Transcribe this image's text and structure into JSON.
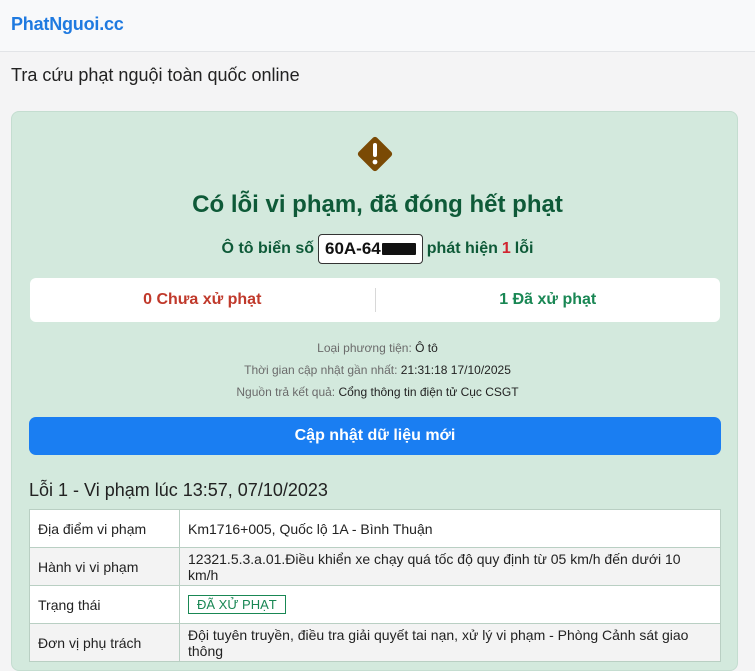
{
  "header": {
    "brand": "PhatNguoi.cc"
  },
  "page": {
    "heading": "Tra cứu phạt nguội toàn quốc online"
  },
  "result": {
    "status_title": "Có lỗi vi phạm, đã đóng hết phạt",
    "plate_prefix": "Ô tô biển số",
    "plate_number": "60A-64",
    "found_prefix": "phát hiện",
    "violation_count": "1",
    "found_suffix": "lỗi",
    "unpaid_label": "0 Chưa xử phạt",
    "paid_label": "1 Đã xử phạt",
    "vehicle_type_label": "Loại phương tiện:",
    "vehicle_type_value": "Ô tô",
    "updated_label": "Thời gian cập nhật gần nhất:",
    "updated_value": "21:31:18 17/10/2025",
    "source_label": "Nguồn trả kết quả:",
    "source_value": "Cổng thông tin điện tử Cục CSGT",
    "update_button": "Cập nhật dữ liệu mới"
  },
  "violation": {
    "title": "Lỗi 1 - Vi phạm lúc 13:57, 07/10/2023",
    "rows": [
      {
        "key": "Địa điểm vi phạm",
        "value": "Km1716+005, Quốc lộ 1A - Bình Thuận"
      },
      {
        "key": "Hành vi vi phạm",
        "value": "12321.5.3.a.01.Điều khiển xe chạy quá tốc độ quy định từ 05 km/h đến dưới 10 km/h"
      },
      {
        "key": "Trạng thái",
        "value": "ĐÃ XỬ PHẠT"
      },
      {
        "key": "Đơn vị phụ trách",
        "value": "Đội tuyên truyền, điều tra giải quyết tai nạn, xử lý vi phạm - Phòng Cảnh sát giao thông"
      }
    ]
  },
  "colors": {
    "brand": "#1f7ae0",
    "success_dark": "#0e5a38",
    "danger": "#d1242f",
    "primary_button": "#1a7ef2",
    "card_bg": "#d3e9dd",
    "warning_icon": "#7a4a05"
  },
  "icons": {
    "status": "warning-icon"
  }
}
